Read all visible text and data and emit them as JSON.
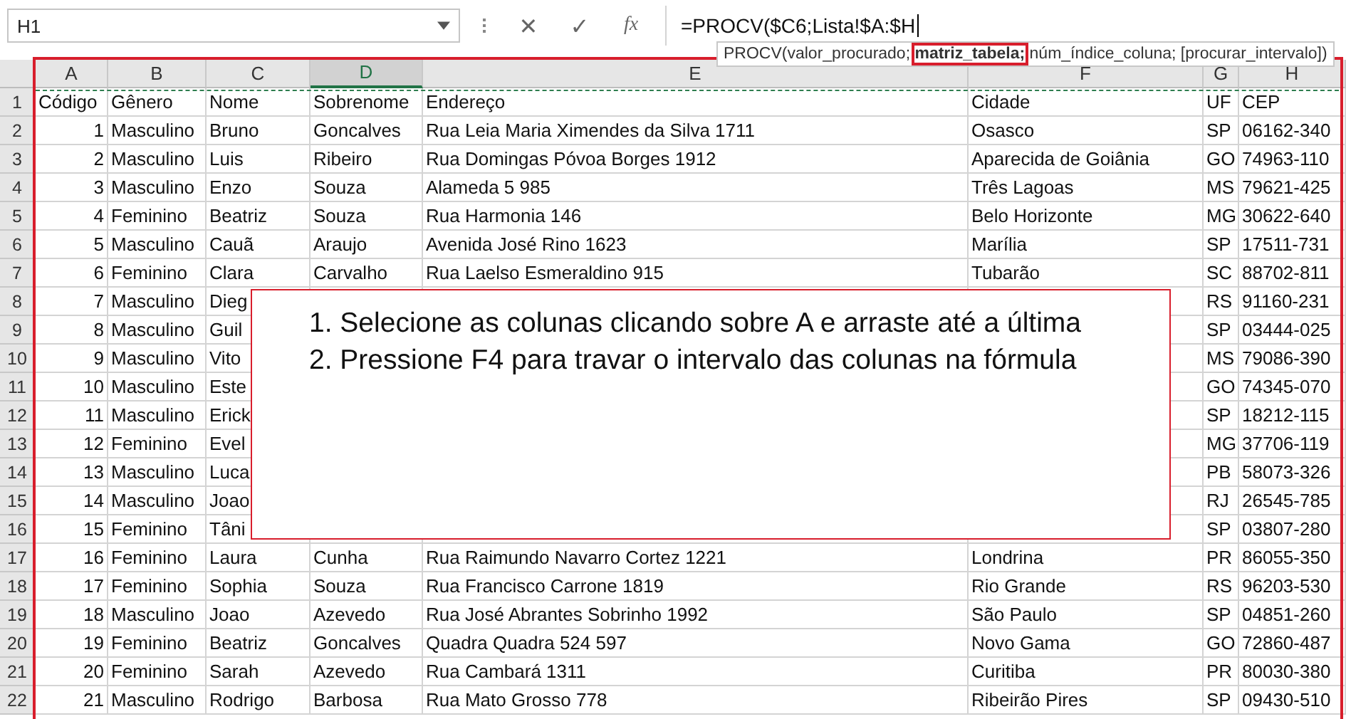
{
  "name_box": {
    "value": "H1"
  },
  "formula_bar": {
    "cancel": "✕",
    "enter": "✓",
    "fx": "fx",
    "formula": "=PROCV($C6;Lista!$A:$H"
  },
  "tooltip": {
    "parts": [
      {
        "text": "PROCV(valor_procurado; ",
        "current": false
      },
      {
        "text": "matriz_tabela;",
        "current": true
      },
      {
        "text": " núm_índice_coluna; [procurar_intervalo])",
        "current": false
      }
    ]
  },
  "columns": [
    {
      "label": "A",
      "selected": false
    },
    {
      "label": "B",
      "selected": false
    },
    {
      "label": "C",
      "selected": false
    },
    {
      "label": "D",
      "selected": true
    },
    {
      "label": "E",
      "selected": false
    },
    {
      "label": "F",
      "selected": false
    },
    {
      "label": "G",
      "selected": false
    },
    {
      "label": "H",
      "selected": false
    }
  ],
  "rows": [
    {
      "number": "1",
      "cells": [
        "Código",
        "Gênero",
        "Nome",
        "Sobrenome",
        "Endereço",
        "Cidade",
        "UF",
        "CEP"
      ]
    },
    {
      "number": "2",
      "cells": [
        "1",
        "Masculino",
        "Bruno",
        "Goncalves",
        "Rua Leia Maria Ximendes da Silva 1711",
        "Osasco",
        "SP",
        "06162-340"
      ]
    },
    {
      "number": "3",
      "cells": [
        "2",
        "Masculino",
        "Luis",
        "Ribeiro",
        "Rua Domingas Póvoa Borges 1912",
        "Aparecida de Goiânia",
        "GO",
        "74963-110"
      ]
    },
    {
      "number": "4",
      "cells": [
        "3",
        "Masculino",
        "Enzo",
        "Souza",
        "Alameda 5 985",
        "Três Lagoas",
        "MS",
        "79621-425"
      ]
    },
    {
      "number": "5",
      "cells": [
        "4",
        "Feminino",
        "Beatriz",
        "Souza",
        "Rua Harmonia 146",
        "Belo Horizonte",
        "MG",
        "30622-640"
      ]
    },
    {
      "number": "6",
      "cells": [
        "5",
        "Masculino",
        "Cauã",
        "Araujo",
        "Avenida José Rino 1623",
        "Marília",
        "SP",
        "17511-731"
      ]
    },
    {
      "number": "7",
      "cells": [
        "6",
        "Feminino",
        "Clara",
        "Carvalho",
        "Rua Laelso Esmeraldino 915",
        "Tubarão",
        "SC",
        "88702-811"
      ]
    },
    {
      "number": "8",
      "cells": [
        "7",
        "Masculino",
        "Dieg",
        null,
        null,
        null,
        "RS",
        "91160-231"
      ]
    },
    {
      "number": "9",
      "cells": [
        "8",
        "Masculino",
        "Guil",
        null,
        null,
        null,
        "SP",
        "03444-025"
      ]
    },
    {
      "number": "10",
      "cells": [
        "9",
        "Masculino",
        "Vito",
        null,
        null,
        null,
        "MS",
        "79086-390"
      ]
    },
    {
      "number": "11",
      "cells": [
        "10",
        "Masculino",
        "Este",
        null,
        null,
        null,
        "GO",
        "74345-070"
      ]
    },
    {
      "number": "12",
      "cells": [
        "11",
        "Masculino",
        "Erick",
        null,
        null,
        null,
        "SP",
        "18212-115"
      ]
    },
    {
      "number": "13",
      "cells": [
        "12",
        "Feminino",
        "Evel",
        null,
        null,
        null,
        "MG",
        "37706-119"
      ]
    },
    {
      "number": "14",
      "cells": [
        "13",
        "Masculino",
        "Luca",
        null,
        null,
        null,
        "PB",
        "58073-326"
      ]
    },
    {
      "number": "15",
      "cells": [
        "14",
        "Masculino",
        "Joao",
        null,
        null,
        null,
        "RJ",
        "26545-785"
      ]
    },
    {
      "number": "16",
      "cells": [
        "15",
        "Feminino",
        "Tâni",
        null,
        null,
        null,
        "SP",
        "03807-280"
      ]
    },
    {
      "number": "17",
      "cells": [
        "16",
        "Feminino",
        "Laura",
        "Cunha",
        "Rua Raimundo Navarro Cortez 1221",
        "Londrina",
        "PR",
        "86055-350"
      ]
    },
    {
      "number": "18",
      "cells": [
        "17",
        "Feminino",
        "Sophia",
        "Souza",
        "Rua Francisco Carrone 1819",
        "Rio Grande",
        "RS",
        "96203-530"
      ]
    },
    {
      "number": "19",
      "cells": [
        "18",
        "Masculino",
        "Joao",
        "Azevedo",
        "Rua José Abrantes Sobrinho 1992",
        "São Paulo",
        "SP",
        "04851-260"
      ]
    },
    {
      "number": "20",
      "cells": [
        "19",
        "Feminino",
        "Beatriz",
        "Goncalves",
        "Quadra Quadra 524 597",
        "Novo Gama",
        "GO",
        "72860-487"
      ]
    },
    {
      "number": "21",
      "cells": [
        "20",
        "Feminino",
        "Sarah",
        "Azevedo",
        "Rua Cambará 1311",
        "Curitiba",
        "PR",
        "80030-380"
      ]
    },
    {
      "number": "22",
      "cells": [
        "21",
        "Masculino",
        "Rodrigo",
        "Barbosa",
        "Rua Mato Grosso 778",
        "Ribeirão Pires",
        "SP",
        "09430-510"
      ]
    }
  ],
  "callout": {
    "lines": [
      "1. Selecione as colunas clicando sobre A e arraste até a última",
      "2. Pressione F4 para travar o intervalo das colunas na fórmula"
    ]
  }
}
